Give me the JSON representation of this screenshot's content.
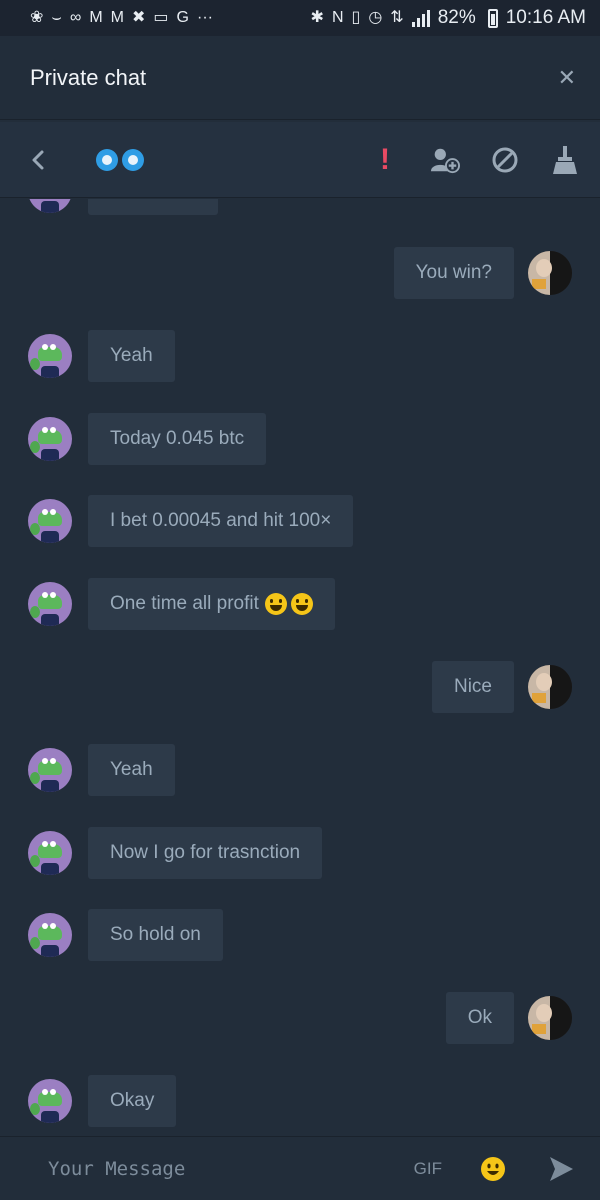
{
  "status_bar": {
    "battery": "82%",
    "time": "10:16 AM",
    "overflow": "···"
  },
  "header": {
    "title": "Private chat",
    "close_glyph": "✕"
  },
  "toolbar": {
    "alert_glyph": "!",
    "icons": [
      "back-icon",
      "eyes-icon",
      "alert-icon",
      "add-friend-icon",
      "block-icon",
      "clear-chat-icon"
    ]
  },
  "messages": [
    {
      "side": "out",
      "text": "You win?"
    },
    {
      "side": "in",
      "text": "Yeah"
    },
    {
      "side": "in",
      "text": "Today 0.045 btc"
    },
    {
      "side": "in",
      "text": "I bet 0.00045 and hit 100×"
    },
    {
      "side": "in",
      "text": "One time all profit",
      "emoji": true
    },
    {
      "side": "out",
      "text": "Nice"
    },
    {
      "side": "in",
      "text": "Yeah"
    },
    {
      "side": "in",
      "text": "Now I go for trasnction"
    },
    {
      "side": "in",
      "text": "So hold on"
    },
    {
      "side": "out",
      "text": "Ok"
    },
    {
      "side": "in",
      "text": "Okay"
    }
  ],
  "composer": {
    "placeholder": "Your Message",
    "gif_label": "GIF"
  },
  "colors": {
    "background": "#222d3a",
    "bubble": "#2d3a49",
    "accent_blue": "#2f9de5",
    "alert_red": "#e84a63",
    "emoji_yellow": "#f5c518"
  }
}
